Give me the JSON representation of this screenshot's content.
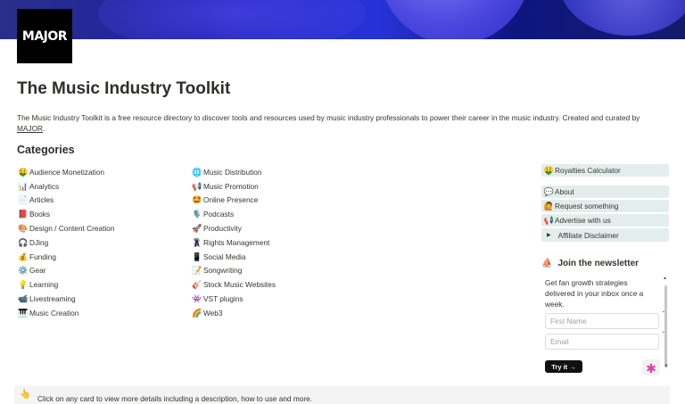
{
  "cover": {
    "accent": "#1c20a8"
  },
  "logo": {
    "text": "MAJOR"
  },
  "page": {
    "title": "The Music Industry Toolkit",
    "description": "The Music Industry Toolkit is a free resource directory to discover tools and resources used by music industry professionals to power their career in the music industry. Created and curated by",
    "description_link": "MAJOR",
    "description_end": "."
  },
  "categories": {
    "heading": "Categories",
    "col1": [
      {
        "icon": "🤑",
        "label": "Audience Monetization"
      },
      {
        "icon": "📊",
        "label": "Analytics"
      },
      {
        "icon": "📄",
        "label": "Articles"
      },
      {
        "icon": "📕",
        "label": "Books"
      },
      {
        "icon": "🎨",
        "label": "Design / Content Creation"
      },
      {
        "icon": "🎧",
        "label": "DJing"
      },
      {
        "icon": "💰",
        "label": "Funding"
      },
      {
        "icon": "⚙️",
        "label": "Gear"
      },
      {
        "icon": "💡",
        "label": "Learning"
      },
      {
        "icon": "📹",
        "label": "Livestreaming"
      },
      {
        "icon": "🎹",
        "label": "Music Creation"
      }
    ],
    "col2": [
      {
        "icon": "🌐",
        "label": "Music Distribution"
      },
      {
        "icon": "📢",
        "label": "Music Promotion"
      },
      {
        "icon": "🤩",
        "label": "Online Presence"
      },
      {
        "icon": "🎙️",
        "label": "Podcasts"
      },
      {
        "icon": "🚀",
        "label": "Productivity"
      },
      {
        "icon": "🦹",
        "label": "Rights Management"
      },
      {
        "icon": "📱",
        "label": "Social Media"
      },
      {
        "icon": "📝",
        "label": "Songwriting"
      },
      {
        "icon": "🎸",
        "label": "Stock Music Websites"
      },
      {
        "icon": "👾",
        "label": "VST plugins"
      },
      {
        "icon": "🌈",
        "label": "Web3"
      }
    ]
  },
  "sidebar": {
    "royalties": {
      "icon": "🤑",
      "label": "Royalties Calculator"
    },
    "about": {
      "icon": "💬",
      "label": "About"
    },
    "request": {
      "icon": "🙋",
      "label": "Request something"
    },
    "advertise": {
      "icon": "📢",
      "label": "Advertise with us"
    },
    "affiliate": {
      "label": "Affiliate Disclaimer"
    }
  },
  "newsletter": {
    "title": "Join the newsletter",
    "text": "Get fan growth strategies delivered in your inbox once a week.",
    "first_name_placeholder": "First Name",
    "email_placeholder": "Email",
    "button": "Try it →"
  },
  "footer": {
    "icon": "👆",
    "text": "Click on any card to view more details including a description, how to use and more."
  }
}
